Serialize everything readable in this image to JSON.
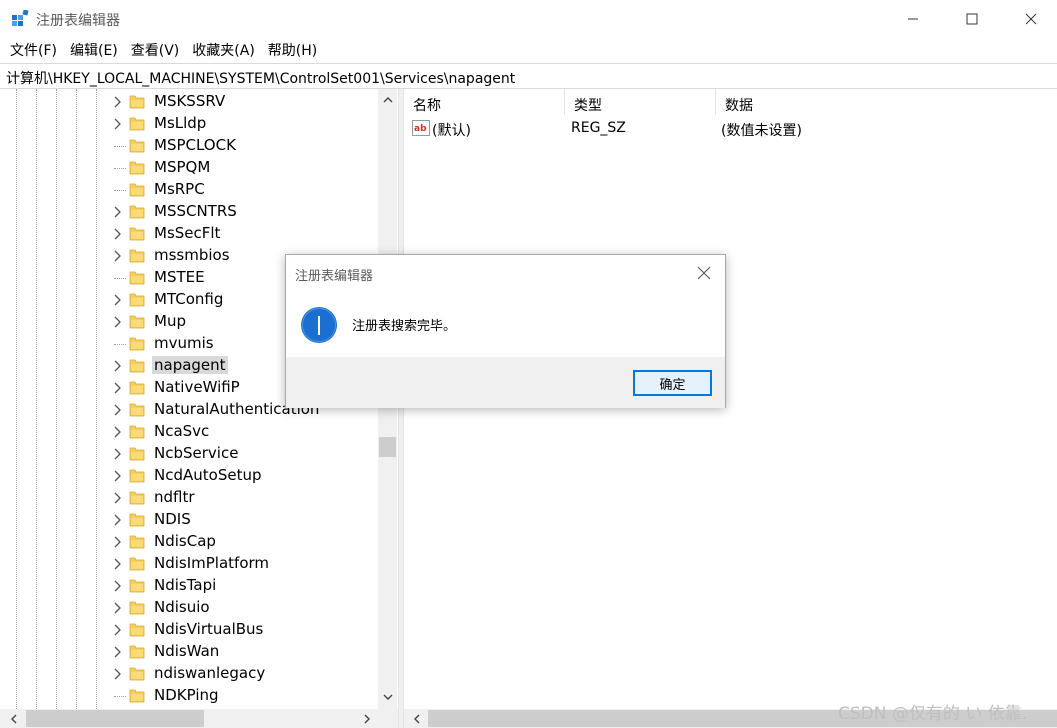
{
  "window": {
    "title": "注册表编辑器",
    "minimize_glyph": "—",
    "maximize_glyph": "☐",
    "close_glyph": "✕"
  },
  "menu": [
    "文件(F)",
    "编辑(E)",
    "查看(V)",
    "收藏夹(A)",
    "帮助(H)"
  ],
  "address": "计算机\\HKEY_LOCAL_MACHINE\\SYSTEM\\ControlSet001\\Services\\napagent",
  "tree": {
    "items": [
      {
        "label": "MSKSSRV",
        "expandable": true
      },
      {
        "label": "MsLldp",
        "expandable": true
      },
      {
        "label": "MSPCLOCK",
        "expandable": false
      },
      {
        "label": "MSPQM",
        "expandable": false
      },
      {
        "label": "MsRPC",
        "expandable": false
      },
      {
        "label": "MSSCNTRS",
        "expandable": true
      },
      {
        "label": "MsSecFlt",
        "expandable": true
      },
      {
        "label": "mssmbios",
        "expandable": true
      },
      {
        "label": "MSTEE",
        "expandable": false
      },
      {
        "label": "MTConfig",
        "expandable": true
      },
      {
        "label": "Mup",
        "expandable": true
      },
      {
        "label": "mvumis",
        "expandable": false
      },
      {
        "label": "napagent",
        "expandable": true,
        "selected": true
      },
      {
        "label": "NativeWifiP",
        "expandable": true
      },
      {
        "label": "NaturalAuthentication",
        "expandable": true
      },
      {
        "label": "NcaSvc",
        "expandable": true
      },
      {
        "label": "NcbService",
        "expandable": true
      },
      {
        "label": "NcdAutoSetup",
        "expandable": true
      },
      {
        "label": "ndfltr",
        "expandable": true
      },
      {
        "label": "NDIS",
        "expandable": true
      },
      {
        "label": "NdisCap",
        "expandable": true
      },
      {
        "label": "NdisImPlatform",
        "expandable": true
      },
      {
        "label": "NdisTapi",
        "expandable": true
      },
      {
        "label": "Ndisuio",
        "expandable": true
      },
      {
        "label": "NdisVirtualBus",
        "expandable": true
      },
      {
        "label": "NdisWan",
        "expandable": true
      },
      {
        "label": "ndiswanlegacy",
        "expandable": true
      },
      {
        "label": "NDKPing",
        "expandable": false
      }
    ]
  },
  "values": {
    "headers": {
      "name": "名称",
      "type": "类型",
      "data": "数据"
    },
    "rows": [
      {
        "name": "(默认)",
        "type": "REG_SZ",
        "data": "(数值未设置)"
      }
    ]
  },
  "dialog": {
    "title": "注册表编辑器",
    "message": "注册表搜索完毕。",
    "ok_label": "确定"
  },
  "watermark": "CSDN @仅有的 い 依靠."
}
